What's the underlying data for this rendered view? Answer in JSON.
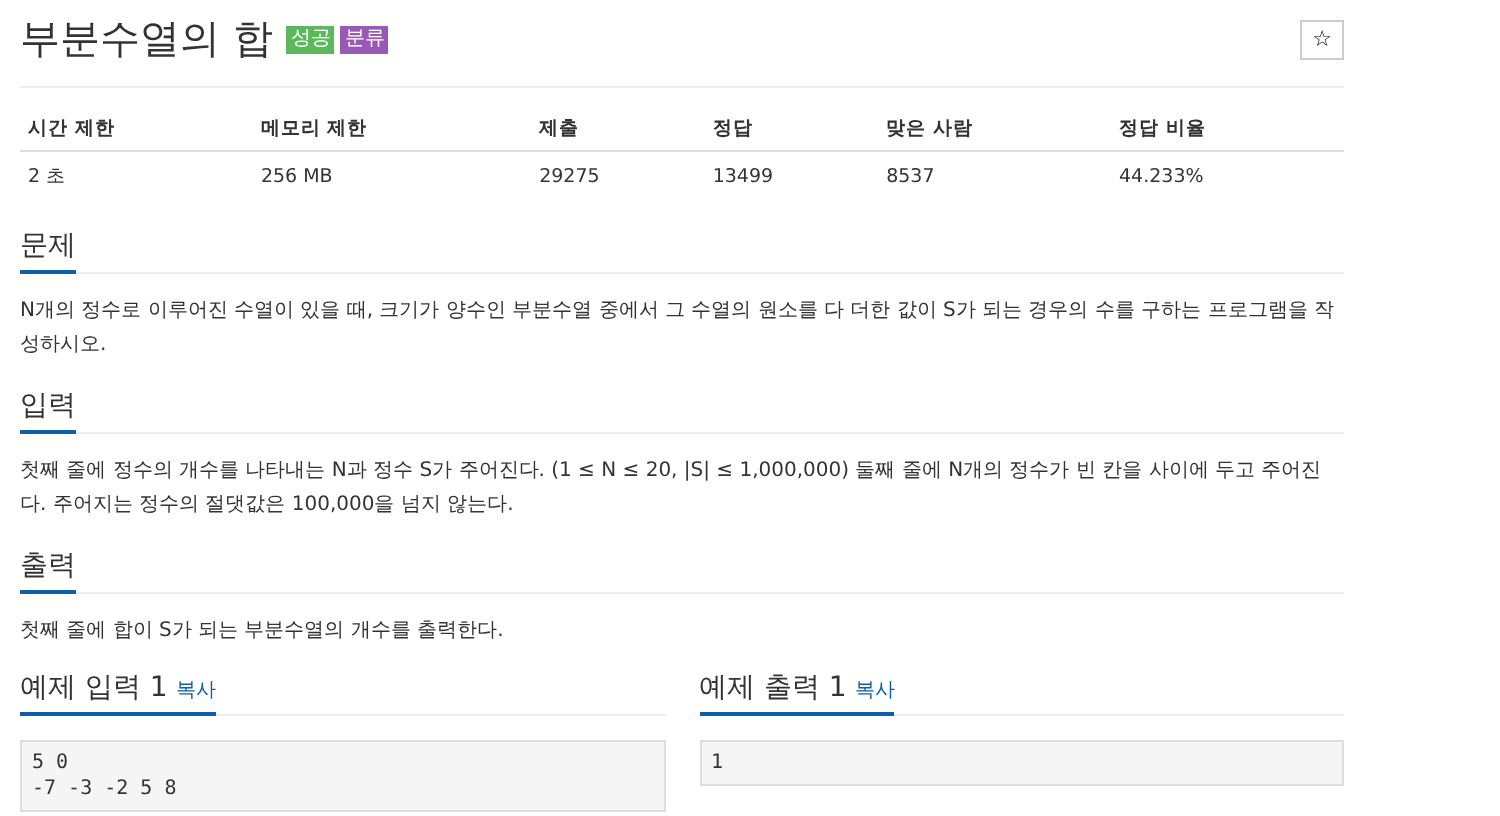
{
  "title": "부분수열의 합",
  "badges": [
    {
      "label": "성공",
      "color": "#5cb85c"
    },
    {
      "label": "분류",
      "color": "#9b59b6"
    }
  ],
  "star_button": {
    "label": "☆"
  },
  "info_table": {
    "columns": [
      "시간 제한",
      "메모리 제한",
      "제출",
      "정답",
      "맞은 사람",
      "정답 비율"
    ],
    "rows": [
      [
        "2 초",
        "256 MB",
        "29275",
        "13499",
        "8537",
        "44.233%"
      ]
    ]
  },
  "sections": [
    {
      "heading": "문제",
      "text": "N개의 정수로 이루어진 수열이 있을 때, 크기가 양수인 부분수열 중에서 그 수열의 원소를 다 더한 값이 S가 되는 경우의 수를 구하는 프로그램을 작성하시오."
    },
    {
      "heading": "입력",
      "text": "첫째 줄에 정수의 개수를 나타내는 N과 정수 S가 주어진다. (1 ≤ N ≤ 20, |S| ≤ 1,000,000) 둘째 줄에 N개의 정수가 빈 칸을 사이에 두고 주어진다. 주어지는 정수의 절댓값은 100,000을 넘지 않는다."
    },
    {
      "heading": "출력",
      "text": "첫째 줄에 합이 S가 되는 부분수열의 개수를 출력한다."
    }
  ],
  "samples": [
    {
      "heading": "예제 입력 1",
      "copy": "복사",
      "lines": [
        "5 0",
        "-7 -3 -2 5 8"
      ]
    },
    {
      "heading": "예제 출력 1",
      "copy": "복사",
      "lines": [
        "1"
      ]
    }
  ]
}
